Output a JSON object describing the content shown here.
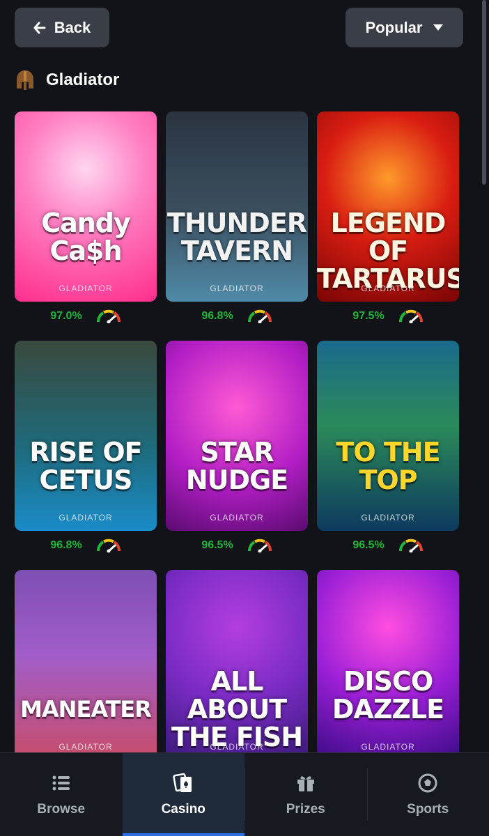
{
  "header": {
    "back_label": "Back",
    "sort_label": "Popular"
  },
  "provider": {
    "name": "Gladiator",
    "icon": "helmet-icon"
  },
  "games": [
    {
      "title": "Candy\nCa$h",
      "provider": "GLADIATOR",
      "rtp": "97.0%"
    },
    {
      "title": "THUNDER\nTAVERN",
      "provider": "GLADIATOR",
      "rtp": "96.8%"
    },
    {
      "title": "LEGEND OF\nTARTARUS",
      "provider": "GLADIATOR",
      "rtp": "97.5%"
    },
    {
      "title": "RISE OF\nCETUS",
      "provider": "GLADIATOR",
      "rtp": "96.8%"
    },
    {
      "title": "STAR\nNUDGE",
      "provider": "GLADIATOR",
      "rtp": "96.5%"
    },
    {
      "title": "TO THE\nTOP",
      "provider": "GLADIATOR",
      "rtp": "96.5%"
    },
    {
      "title": "MANEATER",
      "provider": "GLADIATOR",
      "rtp": ""
    },
    {
      "title": "ALL ABOUT\nTHE FISH",
      "provider": "GLADIATOR",
      "rtp": ""
    },
    {
      "title": "DISCO\nDAZZLE",
      "provider": "GLADIATOR",
      "rtp": ""
    }
  ],
  "nav": {
    "items": [
      {
        "label": "Browse",
        "icon": "list-icon"
      },
      {
        "label": "Casino",
        "icon": "cards-icon"
      },
      {
        "label": "Prizes",
        "icon": "gift-icon"
      },
      {
        "label": "Sports",
        "icon": "soccer-ball-icon"
      }
    ],
    "active": "Casino"
  },
  "colors": {
    "background": "#111318",
    "rtp_green": "#23b43a",
    "active_accent": "#2e6fe0"
  }
}
